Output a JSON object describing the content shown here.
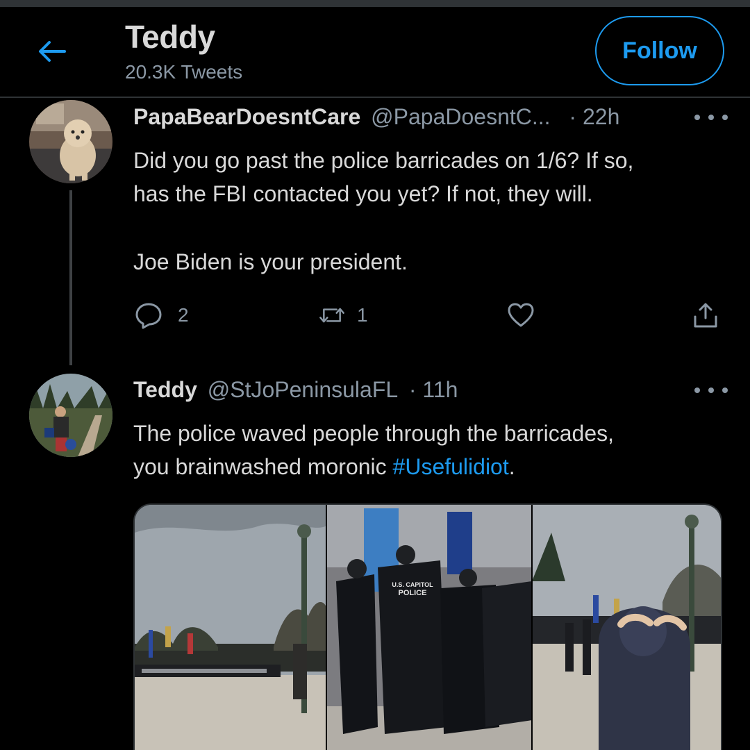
{
  "header": {
    "title": "Teddy",
    "subtitle": "20.3K Tweets",
    "follow_label": "Follow"
  },
  "reply": {
    "name": "PapaBearDoesntCare",
    "handle": "@PapaDoesntC...",
    "time": "· 22h",
    "text_lines": [
      "Did you go past the police barricades on 1/6? If so,",
      "has the FBI contacted you yet?   If not, they will.",
      "Joe Biden is your president."
    ],
    "replies_count": "2",
    "retweets_count": "1",
    "icons": [
      "comment-icon",
      "retweet-icon",
      "like-icon",
      "share-icon"
    ]
  },
  "main_tweet": {
    "name": "Teddy",
    "handle": "@StJoPeninsulaFL",
    "time": "· 11h",
    "text_line1": "The police waved people through the barricades,",
    "text_line2_prefix": "you brainwashed moronic ",
    "hashtag": "#Usefulidiot",
    "text_line2_suffix": ".",
    "media_badges": [
      "U.S. CAPITOL",
      "POLICE"
    ]
  },
  "colors": {
    "background": "#000000",
    "accent": "#1d9bf0",
    "text": "#d9d9d9",
    "secondary": "#8b98a5",
    "divider": "#2f3336"
  }
}
